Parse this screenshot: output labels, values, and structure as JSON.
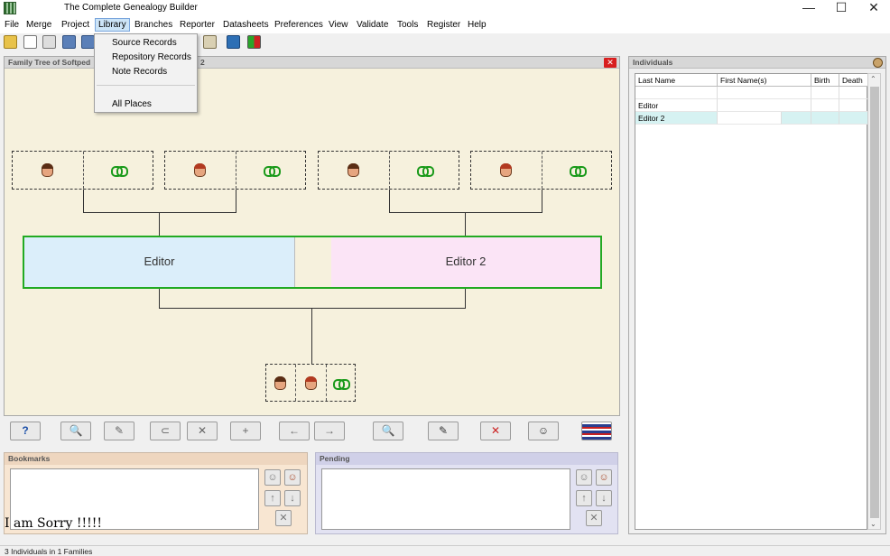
{
  "window": {
    "title": "The Complete Genealogy Builder"
  },
  "menu": [
    "File",
    "Merge",
    "Project",
    "Library",
    "Branches",
    "Reporter",
    "Datasheets",
    "Preferences",
    "View",
    "Validate",
    "Tools",
    "Register",
    "Help"
  ],
  "library_menu": {
    "items": [
      "Source Records",
      "Repository Records",
      "Note Records",
      "All Places"
    ]
  },
  "tree_panel": {
    "title": "Family Tree of Softped",
    "title_suffix": "2",
    "close_icon": "close-icon"
  },
  "couple": {
    "left_name": "Editor",
    "right_name": "Editor 2"
  },
  "individuals_panel": {
    "title": "Individuals",
    "columns": [
      "Last Name",
      "First Name(s)",
      "Birth",
      "Death"
    ],
    "rows": [
      {
        "last": "",
        "first": "",
        "birth": "",
        "death": ""
      },
      {
        "last": "Editor",
        "first": "",
        "birth": "",
        "death": ""
      },
      {
        "last": "Editor 2",
        "first": "",
        "birth": "",
        "death": ""
      }
    ]
  },
  "bookmarks": {
    "title": "Bookmarks"
  },
  "pending": {
    "title": "Pending"
  },
  "overlay_text": "I am Sorry !!!!!",
  "status": "3 Individuals in 1 Families",
  "colors": {
    "couple_border": "#22aa22",
    "tree_bg": "#f6f1dd",
    "close": "#d81e1e"
  }
}
